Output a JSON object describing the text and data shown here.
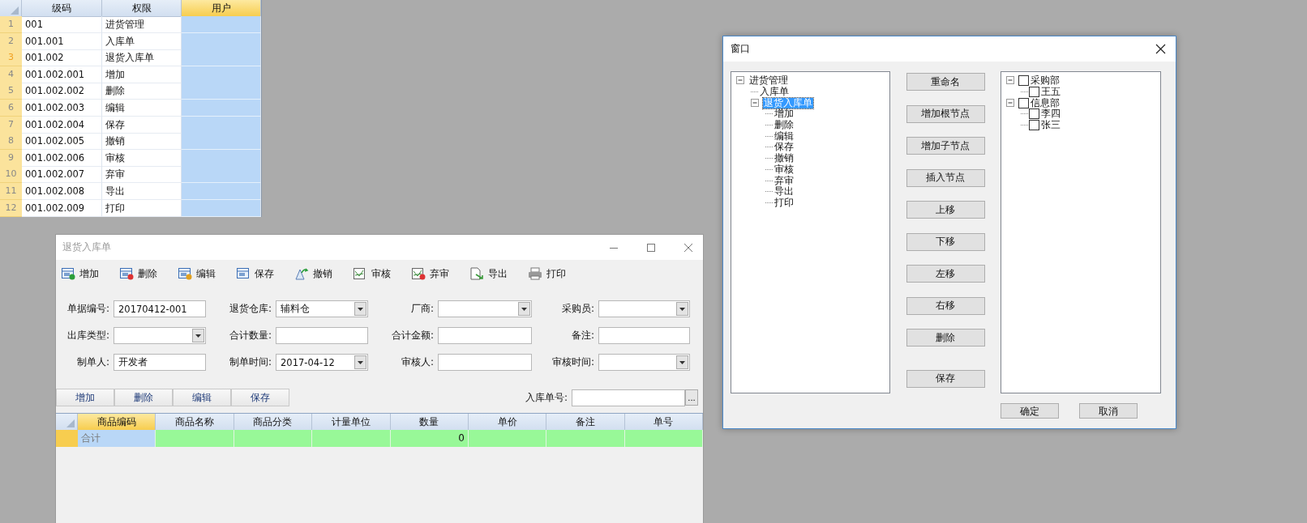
{
  "permission_grid": {
    "columns": [
      {
        "label": "级码",
        "selected": false
      },
      {
        "label": "权限",
        "selected": false
      },
      {
        "label": "用户",
        "selected": true
      }
    ],
    "rows": [
      {
        "num": "1",
        "code": "001",
        "permission": "进货管理",
        "current": false
      },
      {
        "num": "2",
        "code": "001.001",
        "permission": "入库单",
        "current": false
      },
      {
        "num": "3",
        "code": "001.002",
        "permission": "退货入库单",
        "current": true
      },
      {
        "num": "4",
        "code": "001.002.001",
        "permission": "增加",
        "current": false
      },
      {
        "num": "5",
        "code": "001.002.002",
        "permission": "删除",
        "current": false
      },
      {
        "num": "6",
        "code": "001.002.003",
        "permission": "编辑",
        "current": false
      },
      {
        "num": "7",
        "code": "001.002.004",
        "permission": "保存",
        "current": false
      },
      {
        "num": "8",
        "code": "001.002.005",
        "permission": "撤销",
        "current": false
      },
      {
        "num": "9",
        "code": "001.002.006",
        "permission": "审核",
        "current": false
      },
      {
        "num": "10",
        "code": "001.002.007",
        "permission": "弃审",
        "current": false
      },
      {
        "num": "11",
        "code": "001.002.008",
        "permission": "导出",
        "current": false
      },
      {
        "num": "12",
        "code": "001.002.009",
        "permission": "打印",
        "current": false
      }
    ]
  },
  "return_window": {
    "title": "退货入库单",
    "toolbar": [
      {
        "label": "增加",
        "kind": "add"
      },
      {
        "label": "删除",
        "kind": "delete"
      },
      {
        "label": "编辑",
        "kind": "edit"
      },
      {
        "label": "保存",
        "kind": "save"
      },
      {
        "label": "撤销",
        "kind": "undo"
      },
      {
        "label": "审核",
        "kind": "audit"
      },
      {
        "label": "弃审",
        "kind": "unaudit"
      },
      {
        "label": "导出",
        "kind": "export"
      },
      {
        "label": "打印",
        "kind": "print"
      }
    ],
    "fields": [
      {
        "label": "单据编号:",
        "value": "20170412-001",
        "kind": "text"
      },
      {
        "label": "退货仓库:",
        "value": "辅料仓",
        "kind": "combo"
      },
      {
        "label": "厂商:",
        "kind": "combo"
      },
      {
        "label": "采购员:",
        "kind": "combo"
      },
      {
        "label": "出库类型:",
        "kind": "combo"
      },
      {
        "label": "合计数量:",
        "kind": "text"
      },
      {
        "label": "合计金额:",
        "kind": "text"
      },
      {
        "label": "备注:",
        "kind": "text"
      },
      {
        "label": "制单人:",
        "value": "开发者",
        "kind": "text"
      },
      {
        "label": "制单时间:",
        "value": "2017-04-12",
        "kind": "combo"
      },
      {
        "label": "审核人:",
        "kind": "text"
      },
      {
        "label": "审核时间:",
        "kind": "combo"
      }
    ],
    "detail_buttons": [
      "增加",
      "删除",
      "编辑",
      "保存"
    ],
    "receipt_no": {
      "label": "入库单号:",
      "button": "..."
    },
    "grid": {
      "columns": [
        {
          "label": "商品编码",
          "selected": true
        },
        {
          "label": "商品名称",
          "selected": false
        },
        {
          "label": "商品分类",
          "selected": false
        },
        {
          "label": "计量单位",
          "selected": false
        },
        {
          "label": "数量",
          "selected": false
        },
        {
          "label": "单价",
          "selected": false
        },
        {
          "label": "备注",
          "selected": false
        },
        {
          "label": "单号",
          "selected": false
        }
      ],
      "total_row": {
        "label": "合计",
        "quantity": "0"
      }
    }
  },
  "dialog": {
    "title": "窗口",
    "left_tree": [
      {
        "label": "进货管理",
        "selected": false,
        "expanded": true,
        "children": [
          {
            "label": "入库单",
            "selected": false
          },
          {
            "label": "退货入库单",
            "selected": true,
            "expanded": true,
            "children": [
              {
                "label": "增加",
                "selected": false
              },
              {
                "label": "删除",
                "selected": false
              },
              {
                "label": "编辑",
                "selected": false
              },
              {
                "label": "保存",
                "selected": false
              },
              {
                "label": "撤销",
                "selected": false
              },
              {
                "label": "审核",
                "selected": false
              },
              {
                "label": "弃审",
                "selected": false
              },
              {
                "label": "导出",
                "selected": false
              },
              {
                "label": "打印",
                "selected": false
              }
            ]
          }
        ]
      }
    ],
    "buttons": [
      "重命名",
      "增加根节点",
      "增加子节点",
      "插入节点",
      "上移",
      "下移",
      "左移",
      "右移",
      "删除"
    ],
    "save_button": "保存",
    "right_tree": [
      {
        "label": "采购部",
        "checked": false,
        "expanded": true,
        "children": [
          {
            "label": "王五",
            "checked": false
          }
        ]
      },
      {
        "label": "信息部",
        "checked": false,
        "expanded": true,
        "children": [
          {
            "label": "李四",
            "checked": false
          },
          {
            "label": "张三",
            "checked": false
          }
        ]
      }
    ],
    "footer": [
      "确定",
      "取消"
    ]
  }
}
